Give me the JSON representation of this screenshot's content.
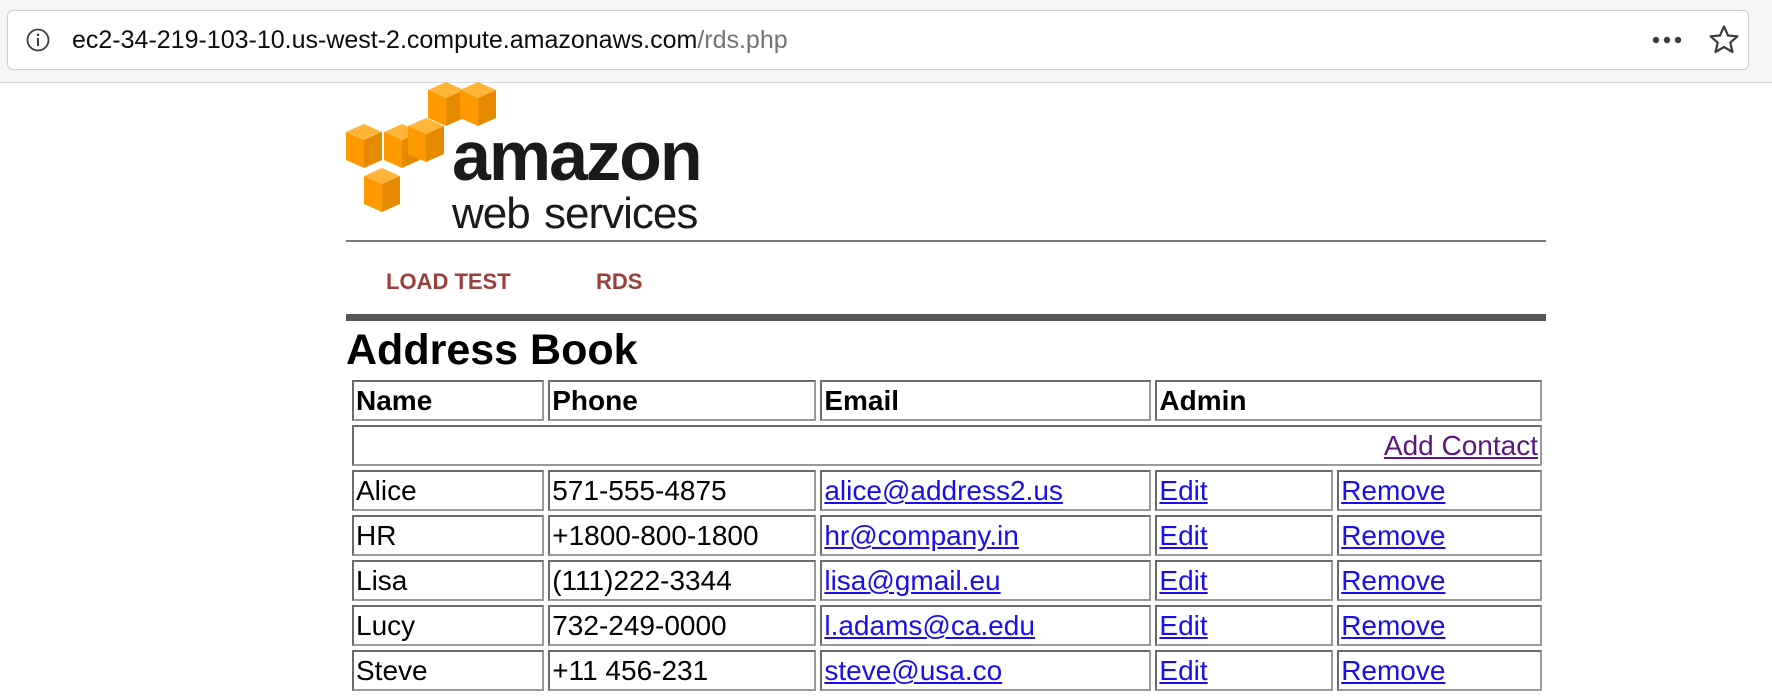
{
  "browser": {
    "url_host": "ec2-34-219-103-10.us-west-2.compute.amazonaws.com",
    "url_path": "/rds.php"
  },
  "logo": {
    "line1": "amazon",
    "line2a": "web",
    "line2b": "services",
    "color_cube": "#FF9900"
  },
  "nav": {
    "items": [
      {
        "label": "LOAD TEST"
      },
      {
        "label": "RDS"
      }
    ]
  },
  "page": {
    "title": "Address Book"
  },
  "table": {
    "headers": [
      "Name",
      "Phone",
      "Email",
      "Admin"
    ],
    "add_contact": "Add Contact",
    "rows": [
      {
        "name": "Alice",
        "phone": "571-555-4875",
        "email": "alice@address2.us",
        "edit": "Edit",
        "remove": "Remove"
      },
      {
        "name": "HR",
        "phone": "+1800-800-1800",
        "email": "hr@company.in",
        "edit": "Edit",
        "remove": "Remove"
      },
      {
        "name": "Lisa",
        "phone": "(111)222-3344",
        "email": "lisa@gmail.eu",
        "edit": "Edit",
        "remove": "Remove"
      },
      {
        "name": "Lucy",
        "phone": "732-249-0000",
        "email": "l.adams@ca.edu",
        "edit": "Edit",
        "remove": "Remove"
      },
      {
        "name": "Steve",
        "phone": "+11 456-231",
        "email": "steve@usa.co",
        "edit": "Edit",
        "remove": "Remove"
      }
    ]
  },
  "colors": {
    "nav_link": "#9a3f3c",
    "link": "#1a0dee",
    "visited_link": "#5a1780"
  }
}
